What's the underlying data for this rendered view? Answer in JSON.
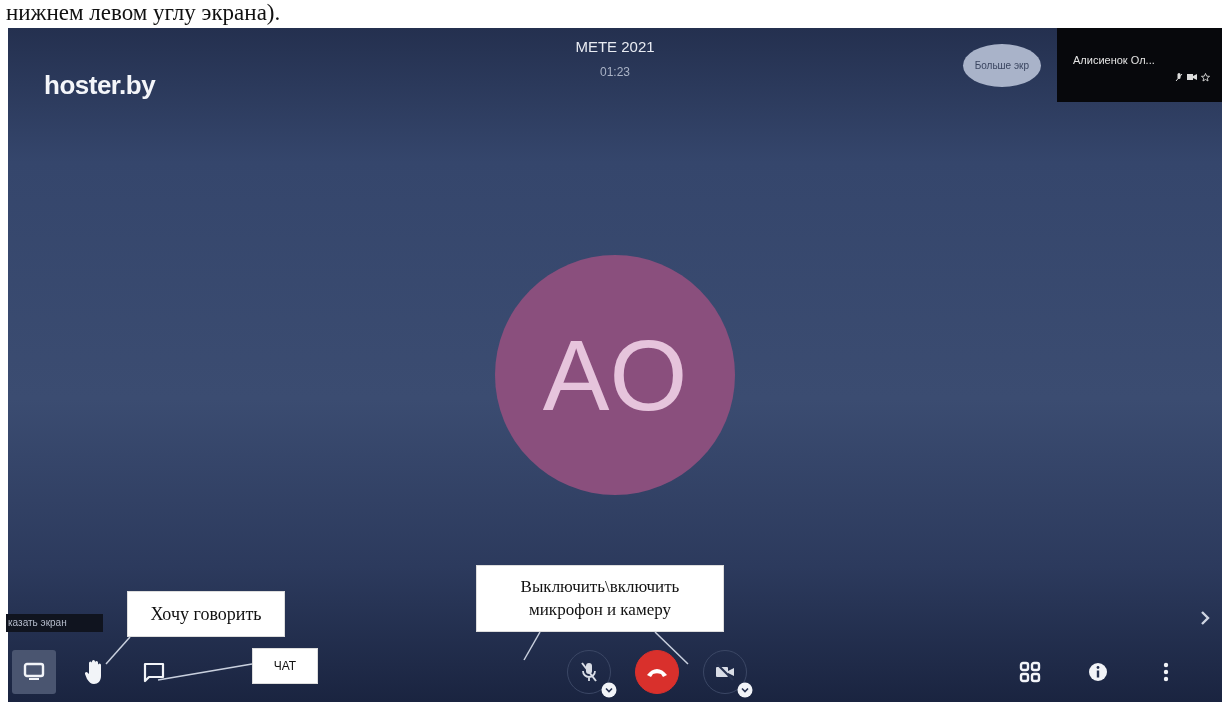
{
  "document_text": "нижнем левом углу экрана).",
  "logo": "hoster.by",
  "meeting": {
    "title": "METE 2021",
    "timer": "01:23"
  },
  "view_toggle": "Больше экр",
  "thumbnail": {
    "name": "Алисиенок Ол..."
  },
  "avatar": {
    "initials": "AO",
    "color": "#8a4f7d"
  },
  "tooltip": "казать экран",
  "toolbar_left": [
    {
      "kind": "screen",
      "selected": true
    },
    {
      "kind": "hand",
      "selected": false
    },
    {
      "kind": "chat",
      "selected": false
    }
  ],
  "toolbar_center": [
    {
      "kind": "mic",
      "muted": true
    },
    {
      "kind": "hangup"
    },
    {
      "kind": "camera",
      "muted": true
    }
  ],
  "toolbar_right": [
    {
      "kind": "grid"
    },
    {
      "kind": "info"
    },
    {
      "kind": "more"
    }
  ],
  "callouts": [
    {
      "kind": "hand",
      "text": "Хочу говорить"
    },
    {
      "kind": "chat",
      "text": "ЧАТ"
    },
    {
      "kind": "devices",
      "text": "Выключить\\включить микрофон и камеру"
    }
  ]
}
